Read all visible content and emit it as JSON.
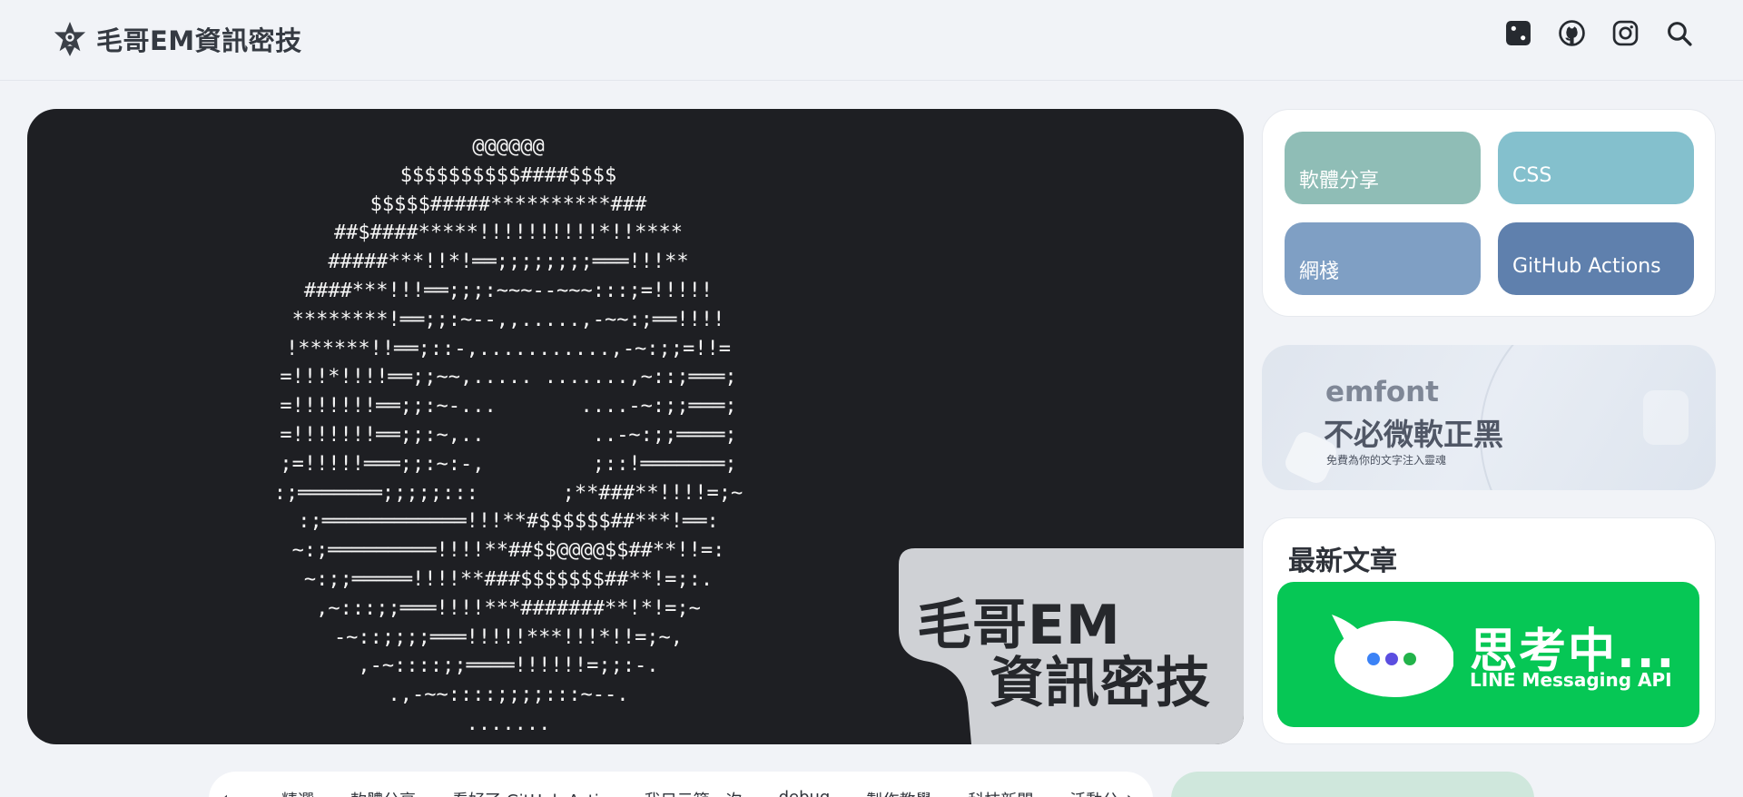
{
  "header": {
    "site_name": "毛哥EM資訊密技",
    "icons": [
      "logo-star-icon",
      "random-dice-icon",
      "github-icon",
      "instagram-icon",
      "search-icon"
    ]
  },
  "hero": {
    "ascii_art": "@@@@@@\n$$$$$$$$$$####$$$$\n$$$$$#####**********###\n##$####*****!!!!!!!!!!*!!****\n#####***!!*!══;;;;;;;;═══!!!**\n####***!!!══;;;:~~~--~~~:::;=!!!!!\n********!══;;:~--,,.....,-~~:;══!!!!\n!******!!══;::-,...........,-~:;;=!!=\n=!!!*!!!!══;;~~,..... .......,~::;═══;\n=!!!!!!!══;;:~-...       ....-~:;;═══;\n=!!!!!!!══;;:~,..         ..-~:;;════;\n;=!!!!!═══;;:~:-,         ;::!═══════;\n:;═══════;;;;;:::       ;**###**!!!!=;~\n:;════════════!!!**#$$$$$$##***!══:\n~:;═════════!!!!**##$$@@@@$$##**!!=:\n~:;;═════!!!!**###$$$$$$$##**!=;:.\n,~:::;;═══!!!!***#######**!*!=;~\n-~::;;;;═══!!!!!***!!!*!!=;~,\n,-~::::;;════!!!!!!=;;:-.\n.,-~~::::;;;;:::~--.\n.......",
    "title_line1": "毛哥EM",
    "title_line2": "資訊密技"
  },
  "categories": [
    {
      "label": "軟體分享",
      "color": "#8fbdb6"
    },
    {
      "label": "CSS",
      "color": "#84c0cd"
    },
    {
      "label": "網棧",
      "color": "#7f9fc4"
    },
    {
      "label": "GitHub Actions",
      "color": "#5f80ad"
    }
  ],
  "emfont": {
    "word": "emfont",
    "title": "不必微軟正黑",
    "subtitle": "免費為你的文字注入靈魂"
  },
  "latest": {
    "heading": "最新文章",
    "card_title": "思考中...",
    "card_subtitle": "LINE Messaging API"
  },
  "tagbar": {
    "left_arrow": "‹",
    "right_arrow": "›",
    "tags": [
      "精選",
      "軟體分享",
      "看好了 GitHub Actions，我只示範一次",
      "debug",
      "製作教學",
      "科技新聞",
      "活動公"
    ]
  }
}
